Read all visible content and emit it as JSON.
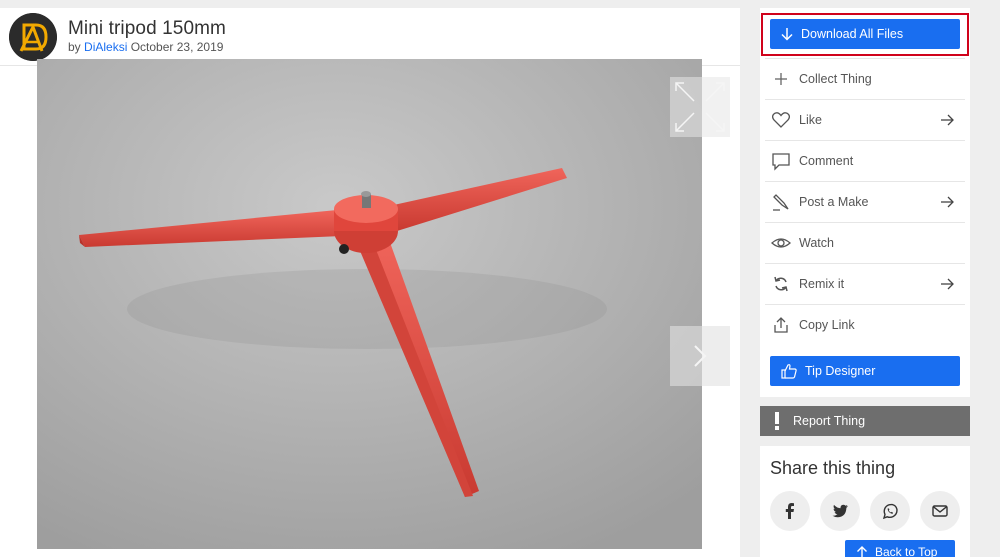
{
  "thing": {
    "title": "Mini tripod 150mm",
    "by_label": "by",
    "author": "DiAleksi",
    "date": "October 23, 2019"
  },
  "gallery": {
    "expand_icon": "expand-icon",
    "next_icon": "chevron-right-icon"
  },
  "sidebar": {
    "download_label": "Download All Files",
    "actions": [
      {
        "label": "Collect Thing",
        "icon": "plus-icon",
        "has_arrow": false
      },
      {
        "label": "Like",
        "icon": "heart-icon",
        "has_arrow": true
      },
      {
        "label": "Comment",
        "icon": "comment-icon",
        "has_arrow": false
      },
      {
        "label": "Post a Make",
        "icon": "make-icon",
        "has_arrow": true
      },
      {
        "label": "Watch",
        "icon": "eye-icon",
        "has_arrow": false
      },
      {
        "label": "Remix it",
        "icon": "remix-icon",
        "has_arrow": true
      },
      {
        "label": "Copy Link",
        "icon": "share-icon",
        "has_arrow": false
      }
    ],
    "tip_label": "Tip Designer",
    "report_label": "Report Thing"
  },
  "share": {
    "title": "Share this thing",
    "buttons": [
      "facebook-icon",
      "twitter-icon",
      "whatsapp-icon",
      "email-icon"
    ]
  },
  "back_to_top_label": "Back to Top",
  "colors": {
    "accent": "#196ef0",
    "highlight": "#d0021b",
    "report": "#6e6e6e",
    "tripod": "#e8453c"
  }
}
